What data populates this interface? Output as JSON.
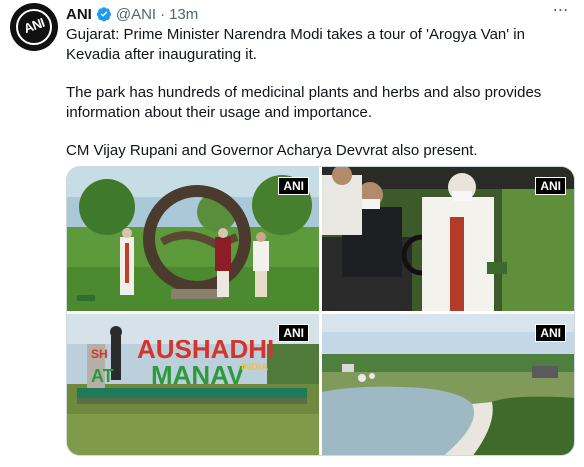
{
  "author": {
    "name": "ANI",
    "handle": "@ANI",
    "separator": "·",
    "time": "13m",
    "verified": true,
    "avatar_logo_text": "ANI"
  },
  "icons": {
    "more": "more-horizontal-icon",
    "verified": "verified-badge-icon"
  },
  "tweet": {
    "paragraph_1": "Gujarat: Prime Minister Narendra Modi takes a tour of 'Arogya Van' in Kevadia after inaugurating it.",
    "paragraph_2": "The park has hundreds of medicinal plants and herbs and also provides information about their usage and importance.",
    "paragraph_3": "CM Vijay Rupani and Governor Acharya Devvrat also present."
  },
  "media": {
    "watermark": "ANI",
    "sign_line_1": "AUSHADHI",
    "sign_line_2": "MANAV",
    "sign_prefix_1": "SH",
    "sign_prefix_2": "AT",
    "sign_suffix": "INDIA"
  },
  "colors": {
    "accent": "#1d9bf0",
    "text": "#0f1419",
    "secondary": "#536471",
    "border": "#cfd9de",
    "sign_red": "#d6342a",
    "sign_green": "#2f9a3c"
  }
}
